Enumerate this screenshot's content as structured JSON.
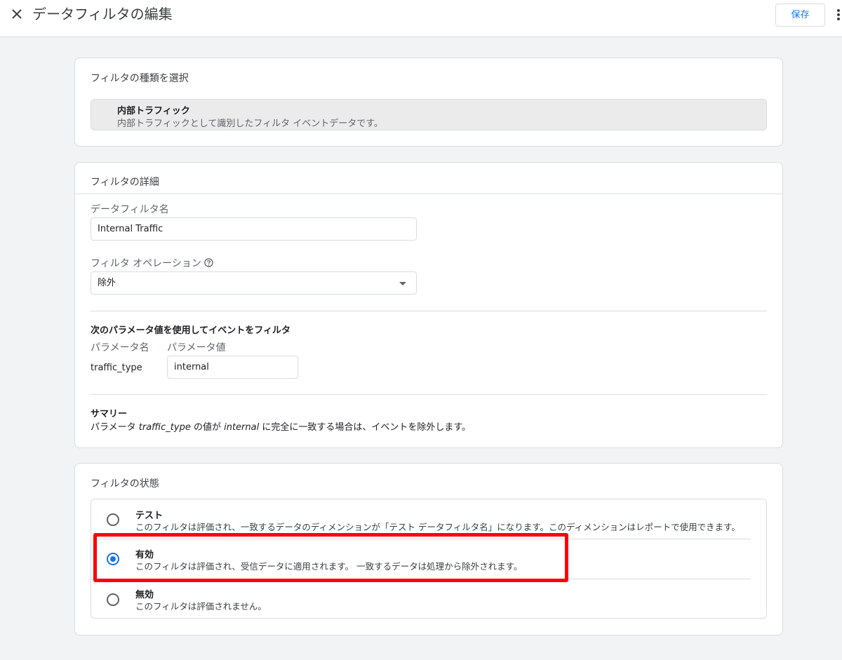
{
  "header": {
    "title": "データフィルタの編集",
    "save_label": "保存"
  },
  "filter_type": {
    "section_title": "フィルタの種類を選択",
    "selected_name": "内部トラフィック",
    "selected_description": "内部トラフィックとして識別したフィルタ イベントデータです。"
  },
  "details": {
    "section_title": "フィルタの詳細",
    "name_label": "データフィルタ名",
    "name_value": "Internal Traffic",
    "operation_label": "フィルタ オペレーション",
    "operation_value": "除外",
    "param_heading": "次のパラメータ値を使用してイベントをフィルタ",
    "param_name_label": "パラメータ名",
    "param_value_label": "パラメータ値",
    "param_name": "traffic_type",
    "param_value": "internal",
    "summary_heading": "サマリー",
    "summary_prefix": "パラメータ ",
    "summary_param": "traffic_type",
    "summary_mid": " の値が ",
    "summary_value": "internal",
    "summary_suffix": " に完全に一致する場合は、イベントを除外します。"
  },
  "status": {
    "section_title": "フィルタの状態",
    "selected": "有効",
    "options": [
      {
        "title": "テスト",
        "description": "このフィルタは評価され、一致するデータのディメンションが「テスト データフィルタ名」になります。このディメンションはレポートで使用できます。"
      },
      {
        "title": "有効",
        "description": "このフィルタは評価され、受信データに適用されます。 一致するデータは処理から除外されます。"
      },
      {
        "title": "無効",
        "description": "このフィルタは評価されません。"
      }
    ]
  },
  "colors": {
    "accent": "#1a73e8",
    "highlight": "#ff0000",
    "background": "#f1f3f4"
  },
  "icons": {
    "close": "close-icon",
    "more": "more-vert-icon",
    "help": "help-icon",
    "dropdown": "arrow-drop-down-icon"
  }
}
